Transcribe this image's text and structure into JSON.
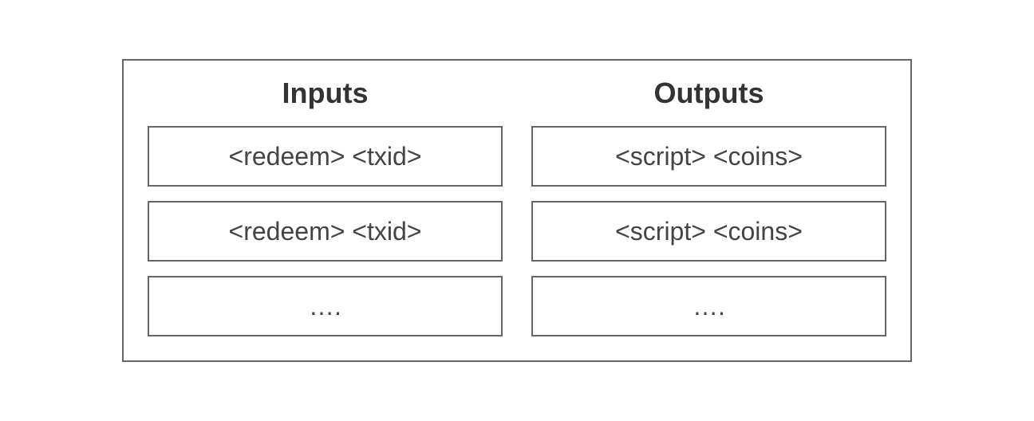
{
  "diagram": {
    "inputs": {
      "header": "Inputs",
      "rows": [
        "<redeem> <txid>",
        "<redeem> <txid>",
        "…."
      ]
    },
    "outputs": {
      "header": "Outputs",
      "rows": [
        "<script> <coins>",
        "<script> <coins>",
        "…."
      ]
    }
  }
}
